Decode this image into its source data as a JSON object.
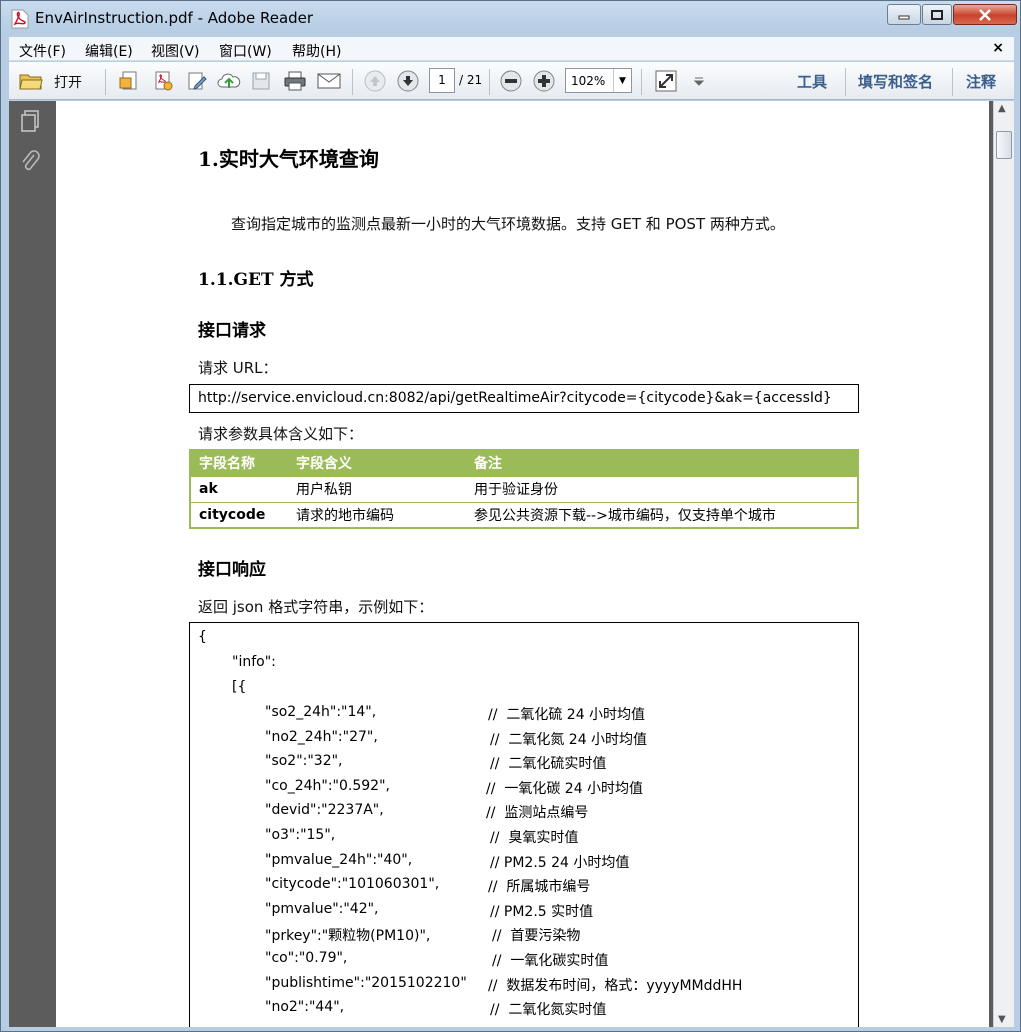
{
  "window": {
    "title": "EnvAirInstruction.pdf - Adobe Reader"
  },
  "menu": {
    "items": [
      "文件(F)",
      "编辑(E)",
      "视图(V)",
      "窗口(W)",
      "帮助(H)"
    ],
    "close": "×"
  },
  "toolbar": {
    "open_label": "打开",
    "page_current": "1",
    "page_total": "/ 21",
    "zoom": "102%",
    "tools": "工具",
    "fill_sign": "填写和签名",
    "comment": "注释"
  },
  "doc": {
    "h1": "1.实时大气环境查询",
    "intro": "查询指定城市的监测点最新一小时的大气环境数据。支持 GET 和 POST 两种方式。",
    "h2": "1.1.GET 方式",
    "request_heading": "接口请求",
    "request_url_label": "请求 URL：",
    "request_url": "http://service.envicloud.cn:8082/api/getRealtimeAir?citycode={citycode}&ak={accessId}",
    "params_label": "请求参数具体含义如下：",
    "table": {
      "headers": [
        "字段名称",
        "字段含义",
        "备注"
      ],
      "rows": [
        [
          "ak",
          "用户私钥",
          "用于验证身份"
        ],
        [
          "citycode",
          "请求的地市编码",
          "参见公共资源下载-->城市编码，仅支持单个城市"
        ]
      ]
    },
    "response_heading": "接口响应",
    "response_label": "返回 json 格式字符串，示例如下：",
    "json": {
      "open_brace": "{",
      "info_key": "\"info\":",
      "open_bracket": "[{",
      "lines": [
        {
          "code": "\"so2_24h\":\"14\",",
          "comment": "//  二氧化硫 24 小时均值"
        },
        {
          "code": "\"no2_24h\":\"27\",",
          "comment": "//  二氧化氮 24 小时均值"
        },
        {
          "code": "\"so2\":\"32\",",
          "comment": "//  二氧化硫实时值"
        },
        {
          "code": "\"co_24h\":\"0.592\",",
          "comment": "//  一氧化碳 24 小时均值"
        },
        {
          "code": "\"devid\":\"2237A\",",
          "comment": "//  监测站点编号"
        },
        {
          "code": "\"o3\":\"15\",",
          "comment": "//  臭氧实时值"
        },
        {
          "code": "\"pmvalue_24h\":\"40\",",
          "comment": "// PM2.5 24 小时均值"
        },
        {
          "code": "\"citycode\":\"101060301\",",
          "comment": "//  所属城市编号"
        },
        {
          "code": "\"pmvalue\":\"42\",",
          "comment": "// PM2.5 实时值"
        },
        {
          "code": "\"prkey\":\"颗粒物(PM10)\",",
          "comment": "//  首要污染物"
        },
        {
          "code": "\"co\":\"0.79\",",
          "comment": "//  一氧化碳实时值"
        },
        {
          "code": "\"publishtime\":\"2015102210\"",
          "comment": "//  数据发布时间，格式：yyyyMMddHH"
        },
        {
          "code": "\"no2\":\"44\",",
          "comment": "//  二氧化氮实时值"
        }
      ]
    }
  }
}
